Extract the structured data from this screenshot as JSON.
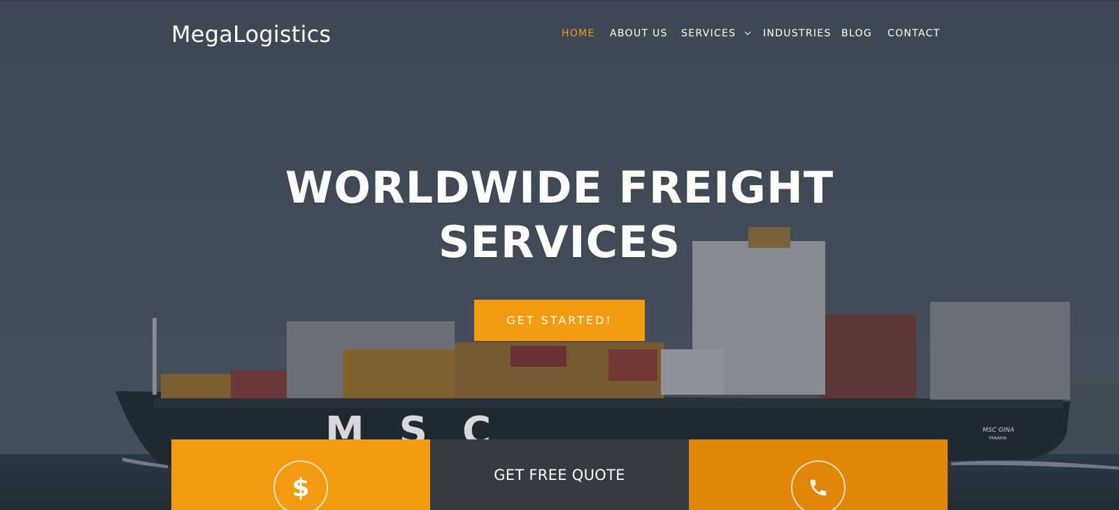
{
  "brand": {
    "logo_text": "MegaLogistics",
    "accent_color": "#f39c12"
  },
  "nav": {
    "items": [
      {
        "label": "HOME",
        "active": true
      },
      {
        "label": "ABOUT US",
        "active": false
      },
      {
        "label": "SERVICES",
        "active": false,
        "has_dropdown": true
      },
      {
        "label": "INDUSTRIES",
        "active": false
      },
      {
        "label": "BLOG",
        "active": false
      },
      {
        "label": "CONTACT",
        "active": false
      }
    ]
  },
  "hero": {
    "headline_line1": "WORLDWIDE FREIGHT",
    "headline_line2": "SERVICES",
    "cta_label": "GET STARTED!",
    "ship_lettering": "MSC",
    "ship_name": "MSC GINA",
    "ship_port": "PANAMA"
  },
  "cards": [
    {
      "icon": "dollar-icon",
      "color": "#f39c12"
    },
    {
      "label": "GET FREE QUOTE",
      "color": "#373a40"
    },
    {
      "icon": "phone-icon",
      "color": "#e2860a"
    }
  ]
}
